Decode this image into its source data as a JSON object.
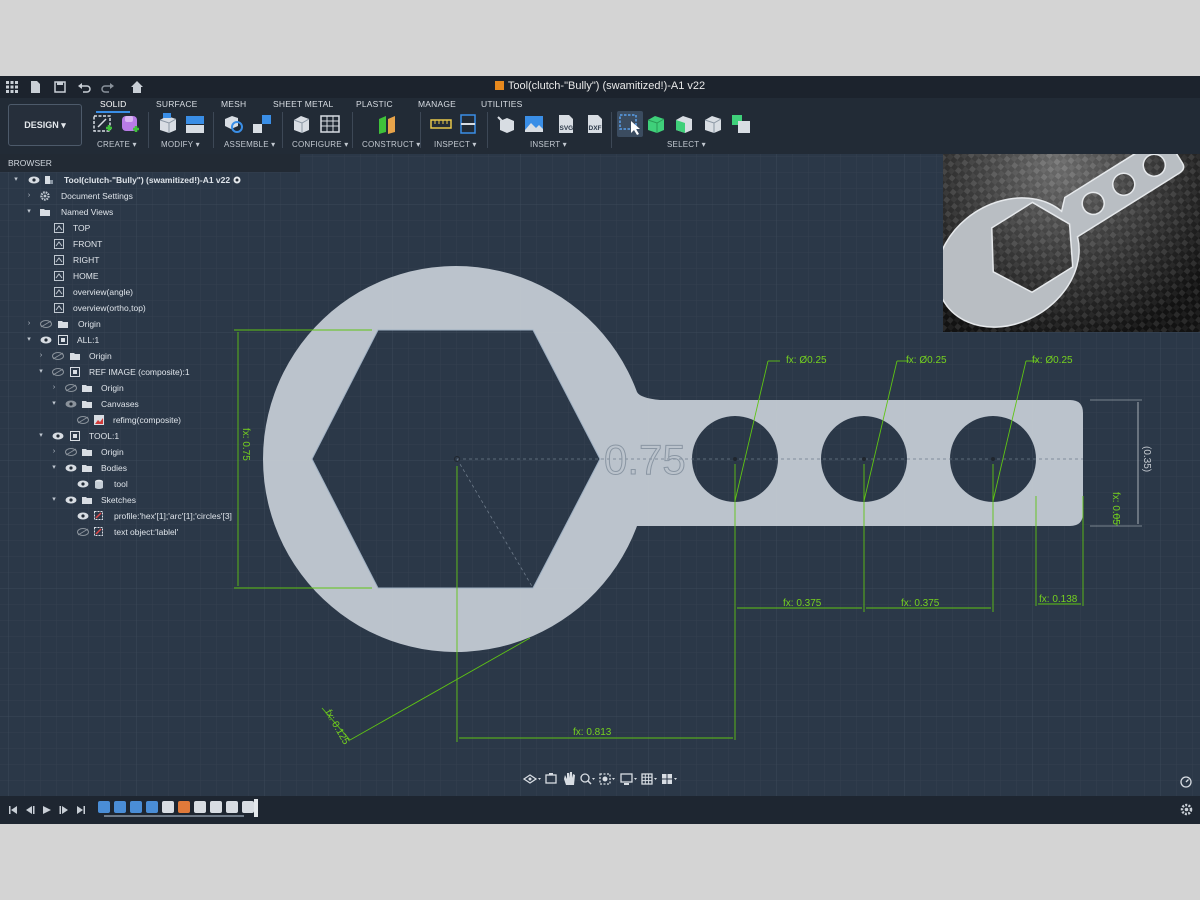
{
  "window": {
    "title": "Tool(clutch-\"Bully\") (swamitized!)-A1 v22"
  },
  "toolbar": {
    "design_label": "DESIGN ▾",
    "tabs": [
      "SOLID",
      "SURFACE",
      "MESH",
      "SHEET METAL",
      "PLASTIC",
      "MANAGE",
      "UTILITIES"
    ],
    "active_tab": "SOLID",
    "groups": [
      "CREATE ▾",
      "MODIFY ▾",
      "ASSEMBLE ▾",
      "CONFIGURE ▾",
      "CONSTRUCT ▾",
      "INSPECT ▾",
      "INSERT ▾",
      "SELECT ▾"
    ]
  },
  "browser": {
    "header": "BROWSER",
    "root": "Tool(clutch-\"Bully\") (swamitized!)-A1 v22",
    "document_settings": "Document Settings",
    "named_views": "Named Views",
    "views": [
      "TOP",
      "FRONT",
      "RIGHT",
      "HOME",
      "overview(angle)",
      "overview(ortho,top)"
    ],
    "origin": "Origin",
    "all": "ALL:1",
    "ref_image": "REF IMAGE (composite):1",
    "canvases": "Canvases",
    "refimg": "refimg(composite)",
    "tool_component": "TOOL:1",
    "bodies": "Bodies",
    "tool_body": "tool",
    "sketches": "Sketches",
    "sketch_1": "profile:'hex'[1];'arc'[1];'circles'[3]",
    "sketch_2": "text object:'lablel'"
  },
  "sketch": {
    "engraved_text": "0.75",
    "dimensions": {
      "hex_height": "fx: 0.75",
      "hole_1": "fx: Ø0.25",
      "hole_2": "fx: Ø0.25",
      "hole_3": "fx: Ø0.25",
      "handle_width": "(0.35)",
      "corner_radius": "fx: 0.05",
      "spacing_1": "fx: 0.375",
      "spacing_2": "fx: 0.375",
      "end_offset": "fx: 0.138",
      "ring_thickness": "fx: 0.125",
      "hex_to_hole": "fx: 0.813"
    }
  },
  "colors": {
    "canvas": "#2b3848",
    "part_fill": "#c6ced6",
    "dimension": "#5fc414",
    "dimension_text": "#75d11f"
  }
}
